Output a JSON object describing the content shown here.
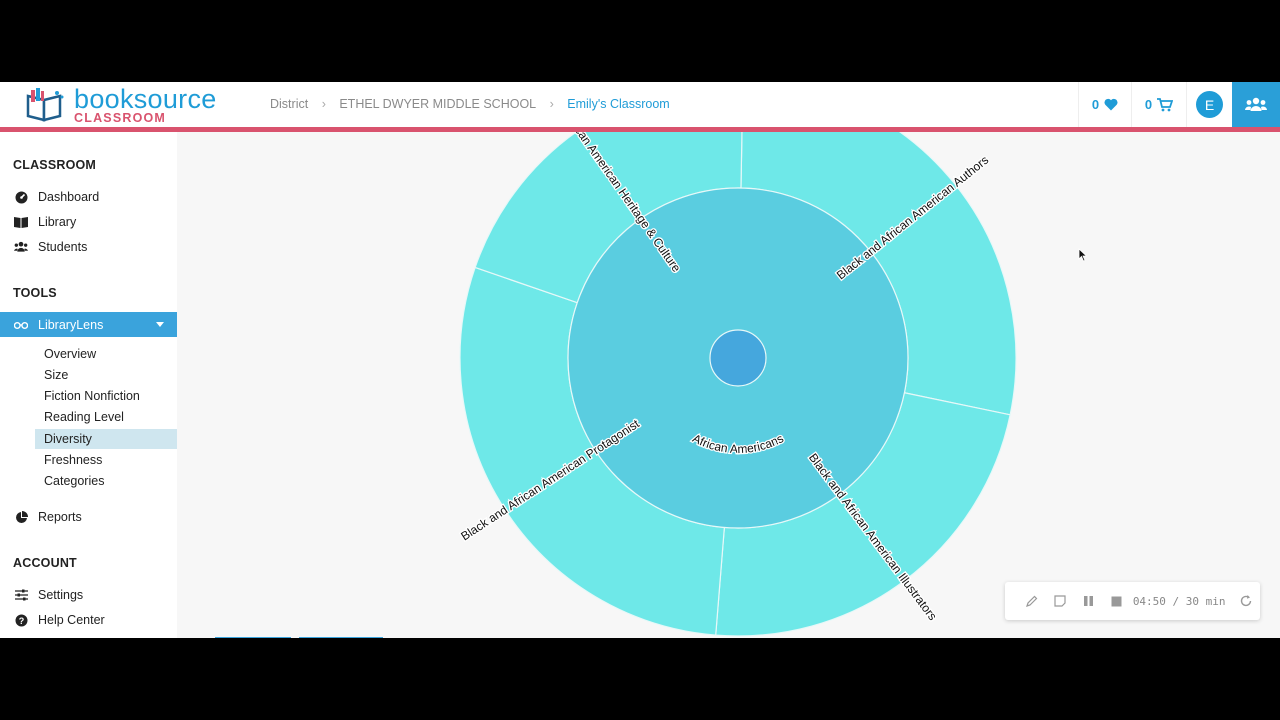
{
  "brand": {
    "name": "booksource",
    "sub": "CLASSROOM"
  },
  "breadcrumb": [
    "District",
    "ETHEL DWYER MIDDLE SCHOOL",
    "Emily's Classroom"
  ],
  "header": {
    "favorites_count": "0",
    "cart_count": "0",
    "user_initial": "E"
  },
  "sidebar": {
    "classroom_title": "CLASSROOM",
    "classroom_items": [
      {
        "label": "Dashboard",
        "icon": "dashboard-icon"
      },
      {
        "label": "Library",
        "icon": "book-icon"
      },
      {
        "label": "Students",
        "icon": "users-icon"
      }
    ],
    "tools_title": "TOOLS",
    "librarylens": {
      "label": "LibraryLens",
      "icon": "glasses-icon"
    },
    "librarylens_items": [
      "Overview",
      "Size",
      "Fiction Nonfiction",
      "Reading Level",
      "Diversity",
      "Freshness",
      "Categories"
    ],
    "active_sub": "Diversity",
    "reports": {
      "label": "Reports",
      "icon": "pie-chart-icon"
    },
    "account_title": "ACCOUNT",
    "account_items": [
      {
        "label": "Settings",
        "icon": "sliders-icon"
      },
      {
        "label": "Help Center",
        "icon": "question-icon"
      }
    ]
  },
  "chart_data": {
    "type": "sunburst",
    "root": "",
    "inner_ring": [
      {
        "label": "African Americans",
        "value": 100
      }
    ],
    "outer_ring": [
      {
        "label": "Black and African American Authors",
        "value": 28
      },
      {
        "label": "Black and African American Illustrators",
        "value": 23
      },
      {
        "label": "Black and African American Protagonist",
        "value": 29
      },
      {
        "label": "Black & African American Heritage & Culture",
        "value": 20
      }
    ],
    "colors": {
      "outer": "#6ee8e8",
      "inner": "#5acde0",
      "center": "#45a7dd"
    }
  },
  "recorder": {
    "time": "04:50 / 30 min"
  }
}
